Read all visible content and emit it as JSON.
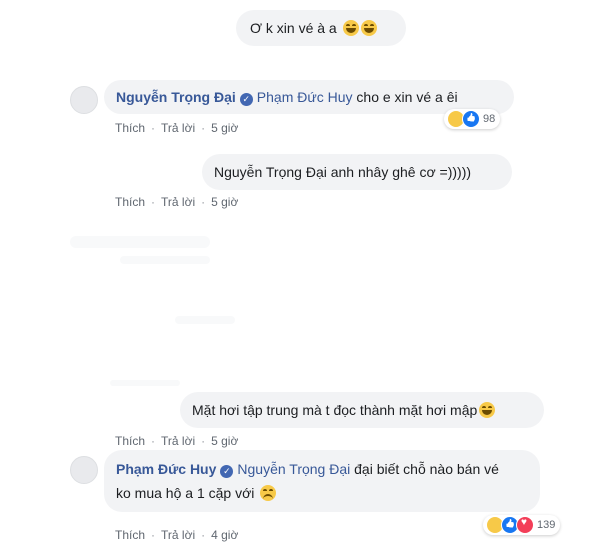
{
  "comments": [
    {
      "text": "Ơ k xin vé à a"
    },
    {
      "author": "Nguyễn Trọng Đại",
      "mention": "Phạm Đức Huy",
      "text": "cho e xin vé a êi",
      "reaction_count": "98"
    },
    {
      "text": "Nguyễn Trọng Đại anh nhây ghê cơ =)))))"
    },
    {
      "text": "Mặt hơi tập trung mà t đọc thành mặt hơi mập"
    },
    {
      "author": "Phạm Đức Huy",
      "mention": "Nguyễn Trọng Đại",
      "text_line1": "đại biết chỗ nào bán vé",
      "text_line2": "ko mua hộ a 1 cặp với",
      "reaction_count": "139"
    }
  ],
  "actions": {
    "like": "Thích",
    "reply": "Trả lời",
    "sep": "·"
  },
  "times": [
    "5 giờ",
    "5 giờ",
    "5 giờ",
    "4 giờ"
  ]
}
